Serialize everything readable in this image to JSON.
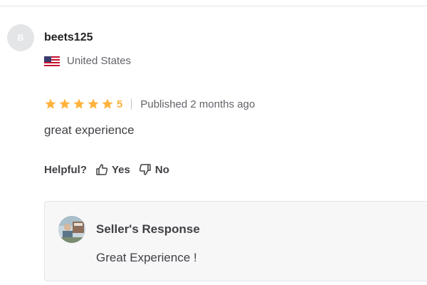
{
  "review": {
    "avatar_initial": "B",
    "username": "beets125",
    "country": "United States",
    "flag_icon": "us-flag-icon",
    "rating": {
      "stars": 5,
      "max": 5,
      "value_label": "5",
      "star_color": "#ffb33e"
    },
    "published": "Published 2 months ago",
    "text": "great experience"
  },
  "helpful": {
    "label": "Helpful?",
    "yes_label": "Yes",
    "no_label": "No",
    "yes_icon": "thumbs-up-icon",
    "no_icon": "thumbs-down-icon"
  },
  "seller_response": {
    "title": "Seller's Response",
    "text": "Great Experience !",
    "avatar_icon": "seller-avatar-image"
  }
}
